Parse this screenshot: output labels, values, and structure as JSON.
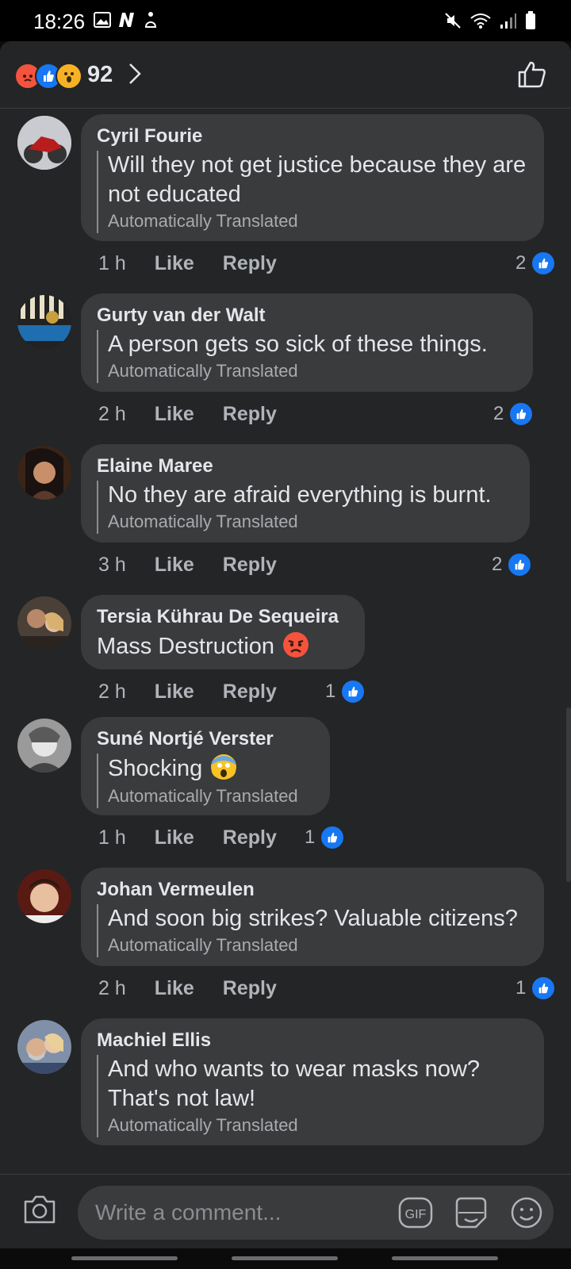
{
  "status_bar": {
    "time": "18:26",
    "left_icons": [
      "image-icon",
      "n-icon",
      "accessibility-icon"
    ],
    "right_icons": [
      "mute-icon",
      "wifi-icon",
      "signal-icon",
      "battery-icon"
    ]
  },
  "reactions": {
    "types": [
      "angry",
      "like",
      "wow"
    ],
    "count": "92"
  },
  "comments": [
    {
      "author": "Cyril Fourie",
      "text": "Will they not get justice because they are not educated",
      "translated": "Automatically Translated",
      "time": "1 h",
      "like_label": "Like",
      "reply_label": "Reply",
      "likes": "2"
    },
    {
      "author": "Gurty van der Walt",
      "text": "A person gets so sick of these things.",
      "translated": "Automatically Translated",
      "time": "2 h",
      "like_label": "Like",
      "reply_label": "Reply",
      "likes": "2"
    },
    {
      "author": "Elaine Maree",
      "text": "No they are afraid everything is burnt.",
      "translated": "Automatically Translated",
      "time": "3 h",
      "like_label": "Like",
      "reply_label": "Reply",
      "likes": "2"
    },
    {
      "author": "Tersia Kührau De Sequeira",
      "text": "Mass Destruction",
      "emoji": "angry-face",
      "time": "2 h",
      "like_label": "Like",
      "reply_label": "Reply",
      "likes": "1"
    },
    {
      "author": "Suné Nortjé Verster",
      "text": "Shocking",
      "emoji": "screaming-face",
      "translated": "Automatically Translated",
      "time": "1 h",
      "like_label": "Like",
      "reply_label": "Reply",
      "likes": "1"
    },
    {
      "author": "Johan Vermeulen",
      "text": "And soon big strikes? Valuable citizens?",
      "translated": "Automatically Translated",
      "time": "2 h",
      "like_label": "Like",
      "reply_label": "Reply",
      "likes": "1"
    },
    {
      "author": "Machiel Ellis",
      "text": "And who wants to wear masks now? That's not law!",
      "translated": "Automatically Translated"
    }
  ],
  "composer": {
    "placeholder": "Write a comment...",
    "gif_label": "GIF"
  },
  "colors": {
    "background": "#242527",
    "bubble": "#3a3b3c",
    "like_blue": "#1877f2",
    "angry": "#f5533d",
    "wow": "#f7b125"
  }
}
